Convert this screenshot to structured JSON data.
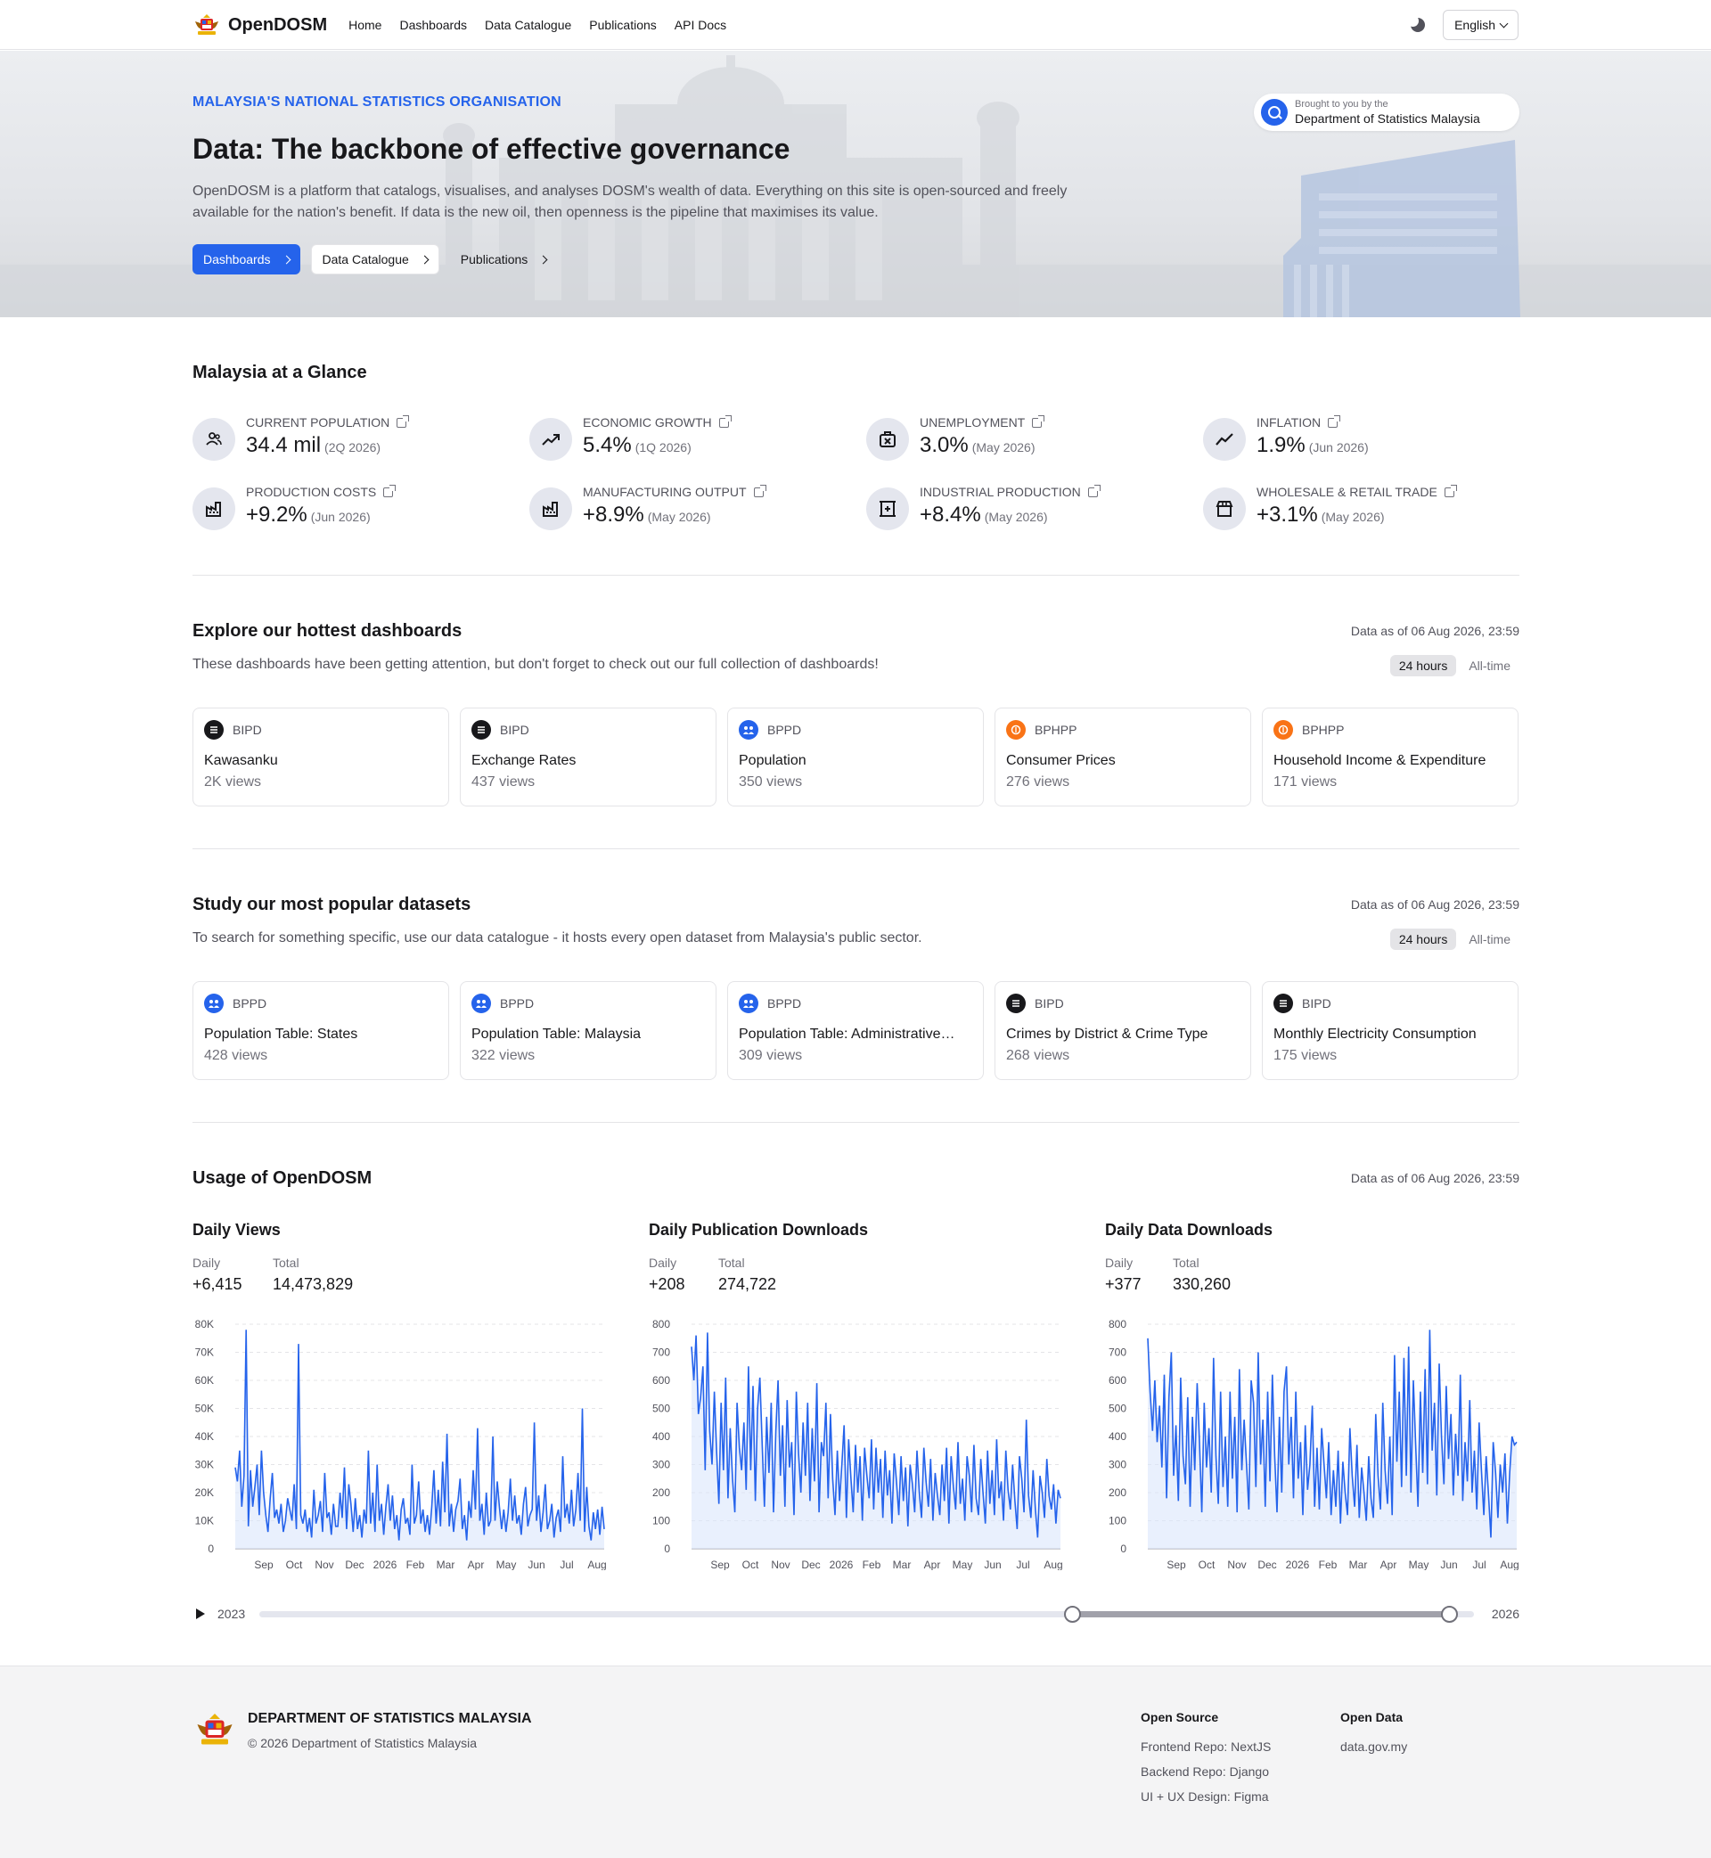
{
  "nav": {
    "brand": "OpenDOSM",
    "links": [
      "Home",
      "Dashboards",
      "Data Catalogue",
      "Publications",
      "API Docs"
    ],
    "theme_icon": "moon-icon",
    "language": "English"
  },
  "hero": {
    "kicker": "MALAYSIA'S NATIONAL STATISTICS ORGANISATION",
    "title": "Data: The backbone of effective governance",
    "description": "OpenDOSM is a platform that catalogs, visualises, and analyses DOSM's wealth of data. Everything on this site is open-sourced and freely available for the nation's benefit. If data is the new oil, then openness is the pipeline that maximises its value.",
    "buttons": [
      "Dashboards",
      "Data Catalogue",
      "Publications"
    ],
    "brought_small": "Brought to you by the",
    "brought_big": "Department of Statistics Malaysia"
  },
  "glance": {
    "title": "Malaysia at a Glance",
    "stats": [
      {
        "label": "Current Population",
        "value": "34.4 mil",
        "period": "(2Q 2026)",
        "icon": "users-icon"
      },
      {
        "label": "Economic Growth",
        "value": "5.4%",
        "period": "(1Q 2026)",
        "icon": "trending-up-icon"
      },
      {
        "label": "Unemployment",
        "value": "3.0%",
        "period": "(May 2026)",
        "icon": "briefcase-x-icon"
      },
      {
        "label": "Inflation",
        "value": "1.9%",
        "period": "(Jun 2026)",
        "icon": "trend-line-icon"
      },
      {
        "label": "Production Costs",
        "value": "+9.2%",
        "period": "(Jun 2026)",
        "icon": "factory-icon"
      },
      {
        "label": "Manufacturing Output",
        "value": "+8.9%",
        "period": "(May 2026)",
        "icon": "factory-icon"
      },
      {
        "label": "Industrial Production",
        "value": "+8.4%",
        "period": "(May 2026)",
        "icon": "industry-icon"
      },
      {
        "label": "Wholesale & Retail Trade",
        "value": "+3.1%",
        "period": "(May 2026)",
        "icon": "store-icon"
      }
    ]
  },
  "dashboards": {
    "title": "Explore our hottest dashboards",
    "asof": "Data as of 06 Aug 2026, 23:59",
    "desc": "These dashboards have been getting attention, but don't forget to check out our full collection of dashboards!",
    "toggle": [
      "24 hours",
      "All-time"
    ],
    "cards": [
      {
        "agency": "BIPD",
        "title": "Kawasanku",
        "views": "2K views",
        "color": "#18181b"
      },
      {
        "agency": "BIPD",
        "title": "Exchange Rates",
        "views": "437 views",
        "color": "#18181b"
      },
      {
        "agency": "BPPD",
        "title": "Population",
        "views": "350 views",
        "color": "#2563eb"
      },
      {
        "agency": "BPHPP",
        "title": "Consumer Prices",
        "views": "276 views",
        "color": "#f97316"
      },
      {
        "agency": "BPHPP",
        "title": "Household Income & Expenditure",
        "views": "171 views",
        "color": "#f97316"
      }
    ]
  },
  "datasets": {
    "title": "Study our most popular datasets",
    "asof": "Data as of 06 Aug 2026, 23:59",
    "desc": "To search for something specific, use our data catalogue - it hosts every open dataset from Malaysia's public sector.",
    "toggle": [
      "24 hours",
      "All-time"
    ],
    "cards": [
      {
        "agency": "BPPD",
        "title": "Population Table: States",
        "views": "428 views",
        "color": "#2563eb"
      },
      {
        "agency": "BPPD",
        "title": "Population Table: Malaysia",
        "views": "322 views",
        "color": "#2563eb"
      },
      {
        "agency": "BPPD",
        "title": "Population Table: Administrative…",
        "views": "309 views",
        "color": "#2563eb"
      },
      {
        "agency": "BIPD",
        "title": "Crimes by District & Crime Type",
        "views": "268 views",
        "color": "#18181b"
      },
      {
        "agency": "BIPD",
        "title": "Monthly Electricity Consumption",
        "views": "175 views",
        "color": "#18181b"
      }
    ]
  },
  "usage": {
    "title": "Usage of OpenDOSM",
    "asof": "Data as of 06 Aug 2026, 23:59",
    "daily_label": "Daily",
    "total_label": "Total",
    "slider_start": "2023",
    "slider_end": "2026",
    "slider_range": [
      0.67,
      0.98
    ]
  },
  "chart_data": [
    {
      "type": "line",
      "title": "Daily Views",
      "daily": "+6,415",
      "total": "14,473,829",
      "ylim": [
        0,
        80000
      ],
      "yticks": [
        "0",
        "10K",
        "20K",
        "30K",
        "40K",
        "50K",
        "60K",
        "70K",
        "80K"
      ],
      "xticks": [
        "Sep",
        "Oct",
        "Nov",
        "Dec",
        "2026",
        "Feb",
        "Mar",
        "Apr",
        "May",
        "Jun",
        "Jul",
        "Aug"
      ],
      "values": [
        29000,
        24000,
        35000,
        15000,
        26000,
        78000,
        8000,
        28000,
        15000,
        22000,
        30000,
        12000,
        35000,
        20000,
        12000,
        6000,
        18000,
        27000,
        11000,
        14000,
        9000,
        16000,
        6000,
        10000,
        18000,
        14000,
        10000,
        23000,
        7000,
        73000,
        12000,
        9000,
        14000,
        6000,
        11000,
        4000,
        21000,
        9000,
        12000,
        17000,
        6000,
        27000,
        11000,
        13000,
        5000,
        16000,
        8000,
        8000,
        20000,
        11000,
        29000,
        7000,
        23000,
        16000,
        6000,
        18000,
        7000,
        12000,
        4000,
        14000,
        9000,
        35000,
        9000,
        20000,
        6000,
        30000,
        10000,
        16000,
        5000,
        15000,
        23000,
        10000,
        19000,
        7000,
        12000,
        3000,
        14000,
        18000,
        9000,
        11000,
        5000,
        30000,
        9000,
        12000,
        24000,
        9000,
        14000,
        6000,
        12000,
        5000,
        15000,
        28000,
        9000,
        21000,
        8000,
        31000,
        13000,
        41000,
        8000,
        16000,
        6000,
        14000,
        17000,
        25000,
        7000,
        12000,
        3000,
        17000,
        11000,
        28000,
        14000,
        43000,
        10000,
        16000,
        5000,
        20000,
        8000,
        10000,
        40000,
        10000,
        24000,
        15000,
        7000,
        14000,
        6000,
        13000,
        25000,
        10000,
        19000,
        9000,
        12000,
        5000,
        16000,
        22000,
        8000,
        12000,
        14000,
        45000,
        10000,
        19000,
        6000,
        13000,
        23000,
        7000,
        10000,
        16000,
        4000,
        11000,
        14000,
        6000,
        33000,
        11000,
        16000,
        9000,
        21000,
        8000,
        14000,
        27000,
        10000,
        50000,
        6000,
        22000,
        8000,
        3000,
        13000,
        7000,
        14000,
        5000,
        15000,
        7000
      ]
    },
    {
      "type": "line",
      "title": "Daily Publication Downloads",
      "daily": "+208",
      "total": "274,722",
      "ylim": [
        0,
        800
      ],
      "yticks": [
        "0",
        "100",
        "200",
        "300",
        "400",
        "500",
        "600",
        "700",
        "800"
      ],
      "xticks": [
        "Sep",
        "Oct",
        "Nov",
        "Dec",
        "2026",
        "Feb",
        "Mar",
        "Apr",
        "May",
        "Jun",
        "Jul",
        "Aug"
      ],
      "values": [
        720,
        600,
        760,
        480,
        540,
        650,
        280,
        770,
        420,
        300,
        560,
        350,
        160,
        520,
        280,
        610,
        180,
        430,
        250,
        130,
        520,
        360,
        280,
        450,
        210,
        650,
        280,
        580,
        170,
        500,
        610,
        380,
        150,
        470,
        270,
        520,
        130,
        420,
        600,
        260,
        440,
        150,
        530,
        290,
        380,
        120,
        560,
        340,
        200,
        450,
        260,
        520,
        170,
        430,
        240,
        590,
        130,
        380,
        330,
        520,
        180,
        480,
        250,
        120,
        350,
        170,
        300,
        440,
        110,
        390,
        250,
        130,
        370,
        200,
        330,
        100,
        360,
        260,
        180,
        390,
        140,
        360,
        200,
        320,
        110,
        350,
        190,
        280,
        90,
        340,
        240,
        120,
        330,
        170,
        290,
        80,
        300,
        230,
        130,
        350,
        200,
        110,
        360,
        240,
        150,
        320,
        100,
        270,
        190,
        120,
        300,
        170,
        360,
        90,
        330,
        220,
        140,
        380,
        160,
        250,
        100,
        330,
        260,
        130,
        370,
        180,
        120,
        320,
        200,
        90,
        350,
        160,
        280,
        120,
        390,
        180,
        240,
        100,
        350,
        210,
        140,
        300,
        170,
        70,
        330,
        250,
        130,
        460,
        190,
        110,
        280,
        140,
        40,
        260,
        200,
        110,
        320,
        190,
        140,
        230,
        90,
        210,
        180
      ]
    },
    {
      "type": "line",
      "title": "Daily Data Downloads",
      "daily": "+377",
      "total": "330,260",
      "ylim": [
        0,
        800
      ],
      "yticks": [
        "0",
        "100",
        "200",
        "300",
        "400",
        "500",
        "600",
        "700",
        "800"
      ],
      "xticks": [
        "Sep",
        "Oct",
        "Nov",
        "Dec",
        "2026",
        "Feb",
        "Mar",
        "Apr",
        "May",
        "Jun",
        "Jul",
        "Aug"
      ],
      "values": [
        750,
        560,
        420,
        600,
        380,
        510,
        290,
        620,
        180,
        540,
        700,
        260,
        440,
        170,
        610,
        330,
        230,
        540,
        150,
        470,
        280,
        590,
        380,
        130,
        520,
        290,
        430,
        200,
        680,
        330,
        160,
        560,
        220,
        400,
        150,
        560,
        250,
        470,
        130,
        640,
        280,
        460,
        300,
        140,
        600,
        520,
        220,
        700,
        300,
        460,
        150,
        560,
        240,
        620,
        330,
        130,
        470,
        200,
        560,
        650,
        300,
        470,
        180,
        560,
        250,
        380,
        120,
        440,
        210,
        300,
        510,
        150,
        360,
        140,
        430,
        300,
        180,
        380,
        120,
        280,
        150,
        350,
        90,
        310,
        200,
        120,
        430,
        260,
        150,
        370,
        110,
        290,
        200,
        100,
        330,
        180,
        110,
        480,
        260,
        140,
        520,
        280,
        160,
        400,
        120,
        690,
        310,
        560,
        220,
        680,
        260,
        720,
        200,
        600,
        370,
        150,
        560,
        270,
        640,
        230,
        780,
        350,
        520,
        190,
        660,
        400,
        230,
        580,
        320,
        480,
        190,
        410,
        260,
        620,
        170,
        380,
        240,
        530,
        200,
        350,
        140,
        450,
        280,
        120,
        330,
        190,
        40,
        380,
        270,
        110,
        300,
        200,
        340,
        90,
        270,
        400,
        370,
        380
      ]
    }
  ],
  "footer": {
    "org": "DEPARTMENT OF STATISTICS MALAYSIA",
    "copyright": "© 2026 Department of Statistics Malaysia",
    "col1_title": "Open Source",
    "col1_links": [
      "Frontend Repo: NextJS",
      "Backend Repo: Django",
      "UI + UX Design: Figma"
    ],
    "col2_title": "Open Data",
    "col2_links": [
      "data.gov.my"
    ]
  }
}
